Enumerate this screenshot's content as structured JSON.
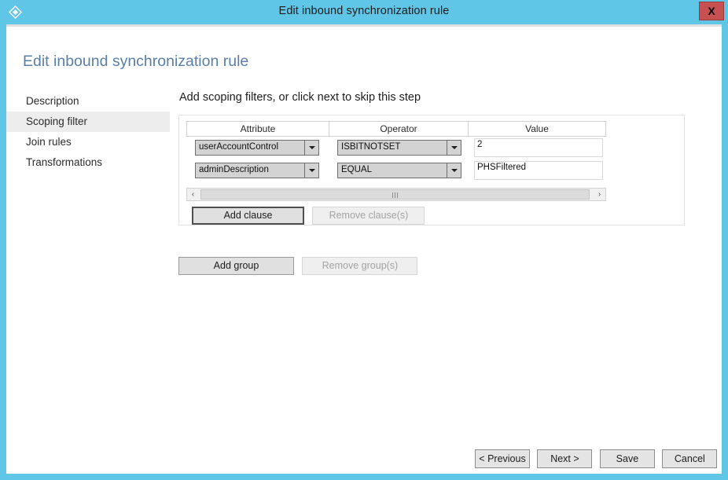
{
  "window": {
    "title": "Edit inbound synchronization rule",
    "icon": "diamond-sync-icon",
    "close_label": "X",
    "titlebar_color": "#5FC6E8",
    "close_button_color": "#C75050"
  },
  "page": {
    "title": "Edit inbound synchronization rule",
    "title_color": "#5A7FA6"
  },
  "sidebar": {
    "items": [
      {
        "label": "Description",
        "selected": false
      },
      {
        "label": "Scoping filter",
        "selected": true
      },
      {
        "label": "Join rules",
        "selected": false
      },
      {
        "label": "Transformations",
        "selected": false
      }
    ],
    "selected_background": "#EDEDED"
  },
  "main": {
    "instruction": "Add scoping filters, or click next to skip this step",
    "grid": {
      "columns": [
        "Attribute",
        "Operator",
        "Value"
      ],
      "rows": [
        {
          "attribute": "userAccountControl",
          "operator": "ISBITNOTSET",
          "value": "2"
        },
        {
          "attribute": "adminDescription",
          "operator": "EQUAL",
          "value": "PHSFiltered"
        }
      ]
    },
    "scrollbar": {
      "left_arrow": "‹",
      "right_arrow": "›",
      "orientation": "horizontal"
    },
    "clause_buttons": [
      {
        "label": "Add clause",
        "enabled": true,
        "focused": true
      },
      {
        "label": "Remove clause(s)",
        "enabled": false,
        "focused": false
      }
    ],
    "group_buttons": [
      {
        "label": "Add group",
        "enabled": true,
        "focused": false
      },
      {
        "label": "Remove group(s)",
        "enabled": false,
        "focused": false
      }
    ]
  },
  "footer": {
    "buttons": [
      {
        "label": "< Previous",
        "enabled": true
      },
      {
        "label": "Next >",
        "enabled": true
      },
      {
        "label": "Save",
        "enabled": true
      },
      {
        "label": "Cancel",
        "enabled": true
      }
    ]
  }
}
